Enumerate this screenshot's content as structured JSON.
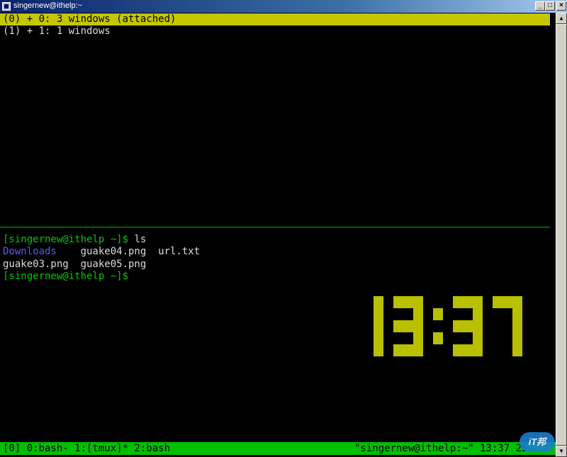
{
  "window": {
    "title": "singernew@ithelp:~",
    "minimize_label": "_",
    "maximize_label": "□",
    "close_label": "×"
  },
  "colors": {
    "terminal_bg": "#000000",
    "selected_session_bg": "#c6c600",
    "status_bar_bg": "#00c000",
    "prompt": "#00c800",
    "directory": "#5858ff",
    "clock": "#b8c000"
  },
  "session_list": [
    {
      "text": "(0) + 0: 3 windows (attached)",
      "selected": true
    },
    {
      "text": "(1) + 1: 1 windows",
      "selected": false
    }
  ],
  "shell": {
    "prompt": "[singernew@ithelp ~]$",
    "command": " ls",
    "listing": {
      "row1": {
        "dir": "Downloads",
        "rest": "    guake04.png  url.txt"
      },
      "row2": "guake03.png  guake05.png"
    },
    "prompt2": "[singernew@ithelp ~]$"
  },
  "clock": {
    "time": "13:37"
  },
  "status_bar": {
    "left": "[0] 0:bash- 1:[tmux]* 2:bash",
    "right": "\"singernew@ithelp:~\" 13:37 25-"
  },
  "scrollbar": {
    "up_icon": "▲",
    "down_icon": "▼"
  },
  "watermark": {
    "text": "iT邦"
  }
}
